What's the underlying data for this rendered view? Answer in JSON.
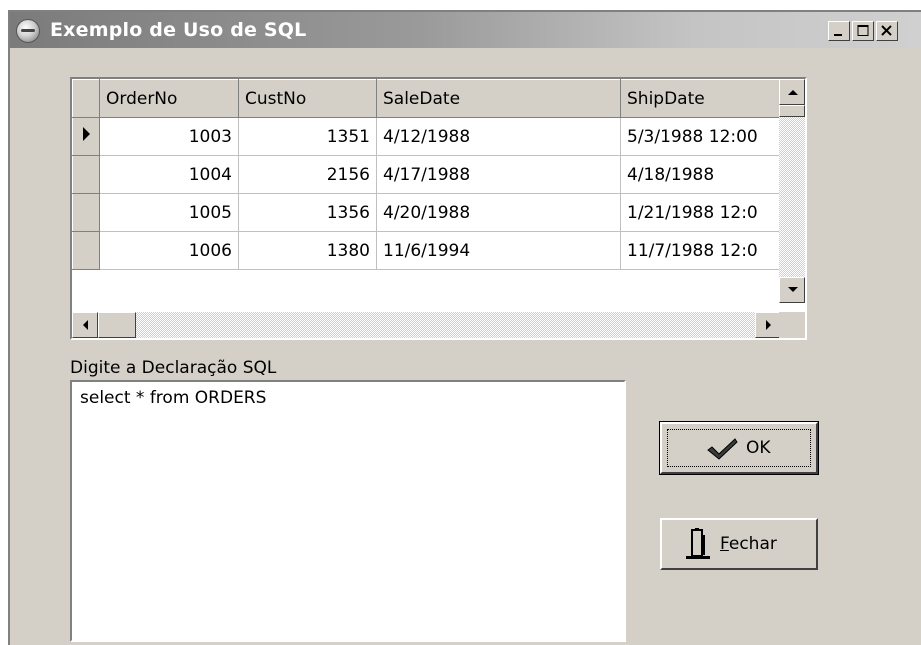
{
  "window": {
    "title": "Exemplo de Uso de SQL"
  },
  "titlebar_buttons": [
    "minimize-icon",
    "maximize-icon",
    "close-icon"
  ],
  "grid": {
    "columns": [
      "OrderNo",
      "CustNo",
      "SaleDate",
      "ShipDate"
    ],
    "rows": [
      [
        "1003",
        "1351",
        "4/12/1988",
        "5/3/1988 12:00"
      ],
      [
        "1004",
        "2156",
        "4/17/1988",
        "4/18/1988"
      ],
      [
        "1005",
        "1356",
        "4/20/1988",
        "1/21/1988 12:0"
      ],
      [
        "1006",
        "1380",
        "11/6/1994",
        "11/7/1988 12:0"
      ]
    ],
    "current_row_indicator": "row-pointer-icon"
  },
  "sql": {
    "label": "Digite a Declaração SQL",
    "value": "select * from ORDERS"
  },
  "buttons": {
    "ok_label": "OK",
    "ok_icon": "checkmark-icon",
    "close_label_underlined": "F",
    "close_label_rest": "echar",
    "close_icon": "door-exit-icon"
  }
}
